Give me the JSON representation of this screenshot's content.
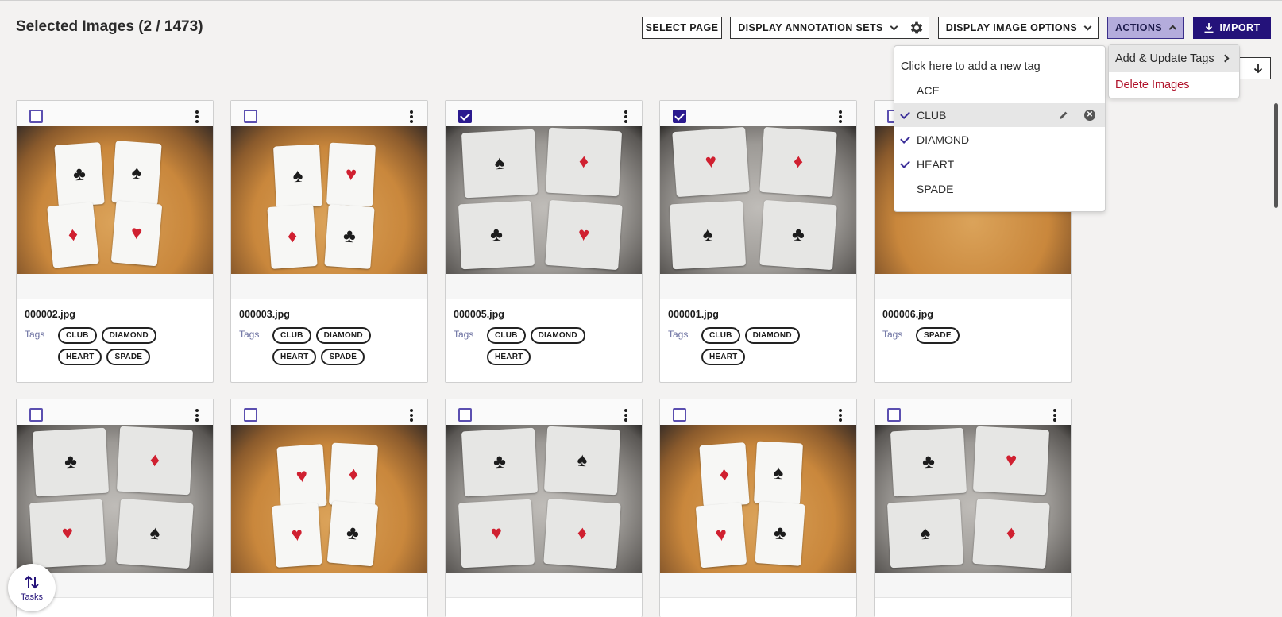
{
  "header": {
    "title": "Selected Images (2 / 1473)",
    "select_page": "SELECT PAGE",
    "display_annotation_sets": "DISPLAY ANNOTATION SETS",
    "display_image_options": "DISPLAY IMAGE OPTIONS",
    "actions": "ACTIONS",
    "import": "IMPORT"
  },
  "actions_menu": {
    "add_update_tags": "Add & Update Tags",
    "delete_images": "Delete Images"
  },
  "tag_menu": {
    "add_new": "Click here to add a new tag",
    "items": [
      {
        "label": "ACE",
        "checked": false
      },
      {
        "label": "CLUB",
        "checked": true
      },
      {
        "label": "DIAMOND",
        "checked": true
      },
      {
        "label": "HEART",
        "checked": true
      },
      {
        "label": "SPADE",
        "checked": false
      }
    ]
  },
  "tags_label": "Tags",
  "cards": [
    {
      "filename": "000002.jpg",
      "selected": false,
      "tags": [
        "CLUB",
        "DIAMOND",
        "HEART",
        "SPADE"
      ]
    },
    {
      "filename": "000003.jpg",
      "selected": false,
      "tags": [
        "CLUB",
        "DIAMOND",
        "HEART",
        "SPADE"
      ]
    },
    {
      "filename": "000005.jpg",
      "selected": true,
      "tags": [
        "CLUB",
        "DIAMOND",
        "HEART"
      ]
    },
    {
      "filename": "000001.jpg",
      "selected": true,
      "tags": [
        "CLUB",
        "DIAMOND",
        "HEART"
      ]
    },
    {
      "filename": "000006.jpg",
      "selected": false,
      "tags": [
        "SPADE"
      ]
    }
  ],
  "tasks": {
    "label": "Tasks"
  },
  "colors": {
    "accent": "#24127a",
    "actions_bg": "#b4acdc",
    "danger": "#b0122a"
  }
}
